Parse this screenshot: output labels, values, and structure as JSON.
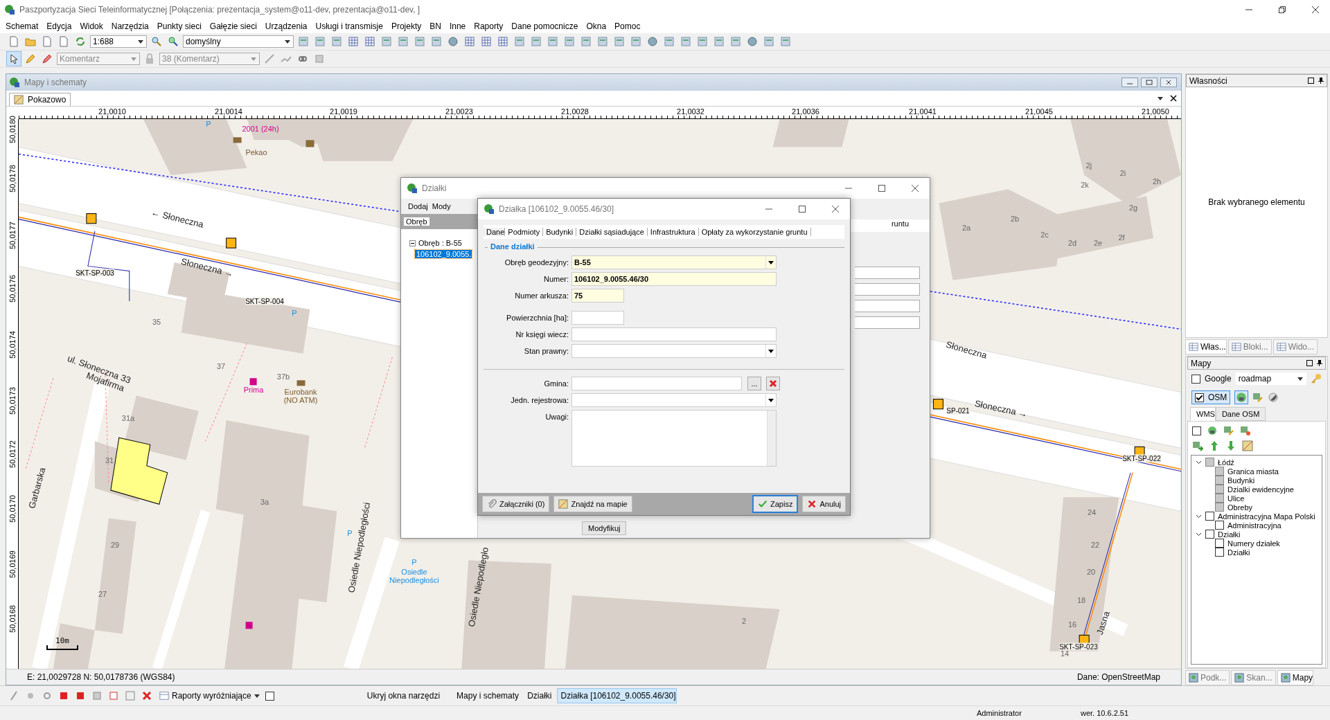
{
  "window": {
    "title": "Paszportyzacja Sieci Teleinformatycznej [Połączenia: prezentacja_system@o11-dev, prezentacja@o11-dev, ]"
  },
  "menu": [
    "Schemat",
    "Edycja",
    "Widok",
    "Narzędzia",
    "Punkty sieci",
    "Gałęzie sieci",
    "Urządzenia",
    "Usługi i transmisje",
    "Projekty",
    "BN",
    "Inne",
    "Raporty",
    "Dane pomocnicze",
    "Okna",
    "Pomoc"
  ],
  "toolbar": {
    "scale": "1:688",
    "style": "domyślny",
    "layer": "Komentarz",
    "count": "38 (Komentarz)"
  },
  "map_window": {
    "title": "Mapy i schematy",
    "tab": "Pokazowo",
    "x_ticks": [
      "21,0010",
      "21,0014",
      "21,0019",
      "21,0023",
      "21,0028",
      "21,0032",
      "21,0036",
      "21,0041",
      "21,0045",
      "21,0050"
    ],
    "y_ticks": [
      "50,0180",
      "50,0178",
      "50,0177",
      "50,0176",
      "50,0174",
      "50,0173",
      "50,0172",
      "50,0170",
      "50,0169",
      "50,0168"
    ],
    "labels": [
      {
        "text": "P",
        "kind": "parking"
      },
      {
        "text": "2001 (24h)",
        "kind": "poi"
      },
      {
        "text": "Pekao",
        "kind": "shop"
      },
      {
        "text": "2j",
        "kind": "number"
      },
      {
        "text": "2i",
        "kind": "number"
      },
      {
        "text": "2h",
        "kind": "number"
      },
      {
        "text": "2k",
        "kind": "number"
      },
      {
        "text": "2g",
        "kind": "number"
      },
      {
        "text": "← Słoneczna",
        "kind": "street"
      },
      {
        "text": "2b",
        "kind": "number"
      },
      {
        "text": "2a",
        "kind": "number"
      },
      {
        "text": "2c",
        "kind": "number"
      },
      {
        "text": "2f",
        "kind": "number"
      },
      {
        "text": "2d",
        "kind": "number"
      },
      {
        "text": "2e",
        "kind": "number"
      },
      {
        "text": "Słoneczna →",
        "kind": "street"
      },
      {
        "text": "SKT-SP-003",
        "kind": "device"
      },
      {
        "text": "SKT-SP-004",
        "kind": "device"
      },
      {
        "text": "P",
        "kind": "parking"
      },
      {
        "text": "35",
        "kind": "number"
      },
      {
        "text": "Słoneczna",
        "kind": "street"
      },
      {
        "text": "37",
        "kind": "number"
      },
      {
        "text": "ul. Słoneczna 33",
        "kind": "street"
      },
      {
        "text": "37b",
        "kind": "number"
      },
      {
        "text": "Mojafirma",
        "kind": "street"
      },
      {
        "text": "Prima",
        "kind": "poi"
      },
      {
        "text": "Eurobank",
        "kind": "shop"
      },
      {
        "text": "(NO ATM)",
        "kind": "shop"
      },
      {
        "text": "Słoneczna →",
        "kind": "street"
      },
      {
        "text": "SP-021",
        "kind": "device"
      },
      {
        "text": "31a",
        "kind": "number"
      },
      {
        "text": "SKT-SP-022",
        "kind": "device"
      },
      {
        "text": "31",
        "kind": "number"
      },
      {
        "text": "Garbarska",
        "kind": "street"
      },
      {
        "text": "3a",
        "kind": "number"
      },
      {
        "text": "24",
        "kind": "number"
      },
      {
        "text": "P",
        "kind": "parking"
      },
      {
        "text": "22",
        "kind": "number"
      },
      {
        "text": "29",
        "kind": "number"
      },
      {
        "text": "Osiedle Niepodległości",
        "kind": "street"
      },
      {
        "text": "P",
        "kind": "parking"
      },
      {
        "text": "Osiedle",
        "kind": "parking"
      },
      {
        "text": "20",
        "kind": "number"
      },
      {
        "text": "Niepodległości",
        "kind": "parking"
      },
      {
        "text": "Osiedle Niepodległo",
        "kind": "street"
      },
      {
        "text": "27",
        "kind": "number"
      },
      {
        "text": "18",
        "kind": "number"
      },
      {
        "text": "2",
        "kind": "number"
      },
      {
        "text": "16",
        "kind": "number"
      },
      {
        "text": "Jasna",
        "kind": "street"
      },
      {
        "text": "SKT-SP-023",
        "kind": "device"
      },
      {
        "text": "14",
        "kind": "number"
      }
    ],
    "scale_bar": "10m",
    "coords": "E: 21,0029728  N: 50,0178736 (WGS84)",
    "source": "Dane: OpenStreetMap"
  },
  "dzialki_window": {
    "title": "Działki",
    "toolbar": [
      "Dodaj",
      "Mody"
    ],
    "group_by": "Obręb",
    "tree": [
      {
        "label": "Obręb : B-55",
        "expanded": true,
        "children": [
          {
            "label": "106102_9.0055.",
            "selected": true
          }
        ]
      }
    ],
    "tab_fragment": "runtu",
    "modify_button": "Modyfikuj"
  },
  "dzialka_dialog": {
    "title": "Działka [106102_9.0055.46/30]",
    "tabs": [
      {
        "label": "Dane",
        "selected": true
      },
      {
        "label": "Podmioty",
        "selected": false
      },
      {
        "label": "Budynki",
        "selected": false
      },
      {
        "label": "Działki sąsiadujące",
        "selected": false
      },
      {
        "label": "Infrastruktura",
        "selected": false
      },
      {
        "label": "Opłaty za wykorzystanie gruntu",
        "selected": false
      }
    ],
    "section": "Dane działki",
    "fields": [
      {
        "label": "Obręb geodezyjny:",
        "kind": "select",
        "required": true,
        "value": "B-55"
      },
      {
        "label": "Numer:",
        "kind": "text",
        "required": true,
        "value": "106102_9.0055.46/30"
      },
      {
        "label": "Numer arkusza:",
        "kind": "short",
        "required": true,
        "value": "75"
      },
      {
        "label": "Powierzchnia [ha]:",
        "kind": "short",
        "required": false
      },
      {
        "label": "Nr księgi wiecz:",
        "kind": "text",
        "required": false
      },
      {
        "label": "Stan prawny:",
        "kind": "select",
        "required": false
      },
      {
        "label": "Gmina:",
        "kind": "picker",
        "required": false,
        "button": "..."
      },
      {
        "label": "Jedn. rejestrowa:",
        "kind": "select",
        "required": false
      },
      {
        "label": "Uwagi:",
        "kind": "memo",
        "required": false
      }
    ],
    "buttons": [
      {
        "label": "Załączniki (0)",
        "kind": "clip",
        "default": false
      },
      {
        "label": "Znajdź na mapie",
        "kind": "map",
        "default": false
      },
      {
        "label": "Zapisz",
        "kind": "ok",
        "default": true
      },
      {
        "label": "Anuluj",
        "kind": "cancel",
        "default": false
      }
    ]
  },
  "properties_panel": {
    "title": "Własności",
    "empty_text": "Brak wybranego elementu",
    "tabs": [
      {
        "label": "Włas...",
        "selected": true
      },
      {
        "label": "Bloki...",
        "selected": false
      },
      {
        "label": "Wido...",
        "selected": false
      }
    ]
  },
  "maps_panel": {
    "title": "Mapy",
    "google": {
      "label": "Google",
      "checked": false,
      "mode": "roadmap"
    },
    "osm": {
      "label": "OSM",
      "checked": true
    },
    "tabs": [
      {
        "label": "WMS",
        "selected": true
      },
      {
        "label": "Dane OSM",
        "selected": false
      }
    ],
    "wms_checked": false,
    "layers": [
      {
        "label": "Łódź",
        "checked": false,
        "disabled": true,
        "expanded": true,
        "children": [
          {
            "label": "Granica miasta",
            "checked": false,
            "disabled": true
          },
          {
            "label": "Budynki",
            "checked": false,
            "disabled": true
          },
          {
            "label": "Dzialki ewidencyjne",
            "checked": false,
            "disabled": true
          },
          {
            "label": "Ulice",
            "checked": false,
            "disabled": true
          },
          {
            "label": "Obreby",
            "checked": false,
            "disabled": true
          }
        ]
      },
      {
        "label": "Administracyjna Mapa Polski",
        "checked": false,
        "disabled": false,
        "expanded": true,
        "children": [
          {
            "label": "Administracyjna",
            "checked": false,
            "disabled": false
          }
        ]
      },
      {
        "label": "Działki",
        "checked": false,
        "disabled": false,
        "expanded": true,
        "children": [
          {
            "label": "Numery działek",
            "checked": false,
            "disabled": false
          },
          {
            "label": "Działki",
            "checked": false,
            "disabled": false
          }
        ]
      }
    ],
    "bottom_tabs": [
      {
        "label": "Podk...",
        "selected": false
      },
      {
        "label": "Skan...",
        "selected": false
      },
      {
        "label": "Mapy",
        "selected": true
      }
    ]
  },
  "taskbar": {
    "reports": "Raporty wyróżniające",
    "option_checked": false,
    "hide_tools": "Ukryj okna narzędzi",
    "windows": [
      {
        "label": "Mapy i schematy",
        "selected": false
      },
      {
        "label": "Działki",
        "selected": false
      },
      {
        "label": "Działka [106102_9.0055.46/30]",
        "selected": true
      }
    ]
  },
  "status_bar": {
    "user": "Administrator",
    "version": "wer. 10.6.2.51"
  }
}
